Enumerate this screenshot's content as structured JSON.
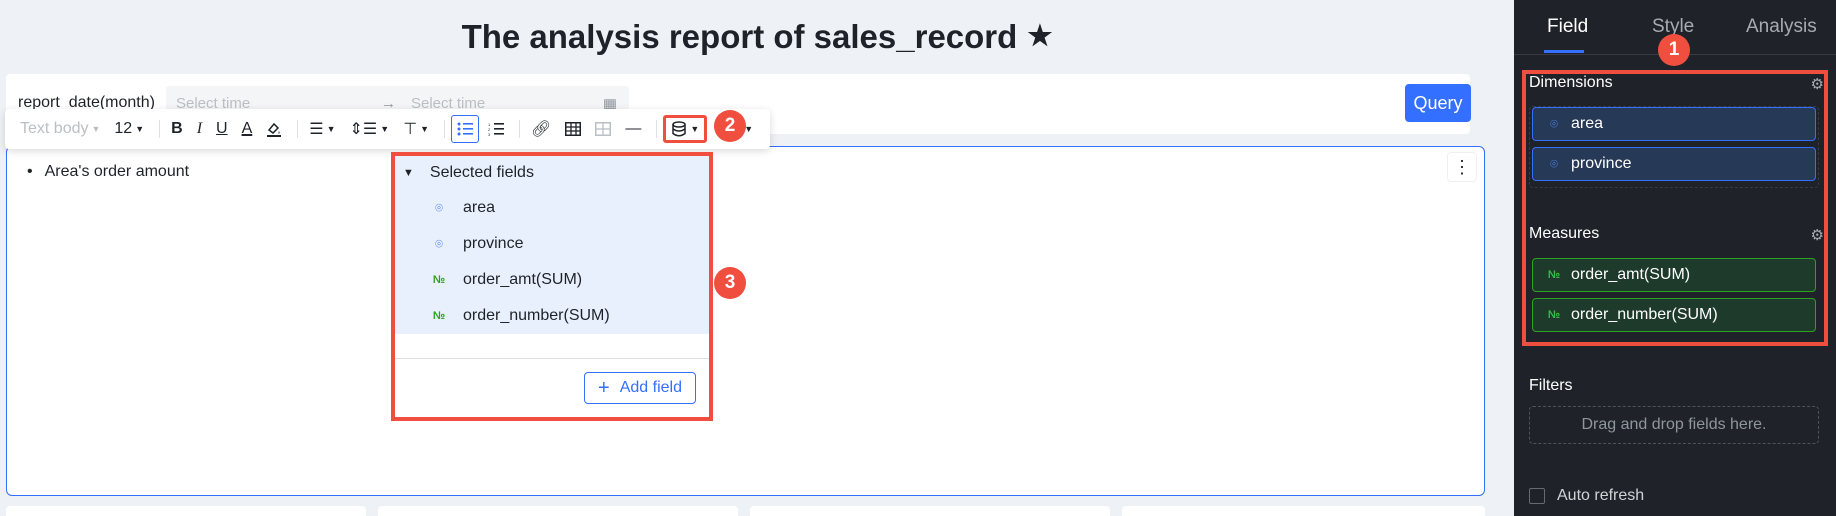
{
  "report": {
    "title": "The analysis report of sales_record",
    "star_icon": "star-icon"
  },
  "filter": {
    "label": "report_date(month)",
    "start_placeholder": "Select time",
    "end_placeholder": "Select time",
    "arrow": "→",
    "query_label": "Query"
  },
  "toolbar": {
    "paragraph_style": "Text body",
    "font_size": "12",
    "bold": "B",
    "italic": "I",
    "underline": "U",
    "font_color": "A"
  },
  "editor": {
    "bullet_text": "Area's order amount"
  },
  "dropdown": {
    "header": "Selected fields",
    "items": [
      {
        "label": "area",
        "type": "geo"
      },
      {
        "label": "province",
        "type": "geo"
      },
      {
        "label": "order_amt(SUM)",
        "type": "num"
      },
      {
        "label": "order_number(SUM)",
        "type": "num"
      }
    ],
    "add_label": "Add field"
  },
  "badges": [
    "1",
    "2",
    "3"
  ],
  "panel": {
    "tabs": [
      "Field",
      "Style",
      "Analysis"
    ],
    "active_tab": "Field",
    "dimensions_title": "Dimensions",
    "dimensions": [
      "area",
      "province"
    ],
    "measures_title": "Measures",
    "measures": [
      "order_amt(SUM)",
      "order_number(SUM)"
    ],
    "filters_title": "Filters",
    "drop_hint": "Drag and drop fields here.",
    "auto_refresh": "Auto refresh"
  },
  "colors": {
    "accent": "#3370ff",
    "highlight": "#f04e3e",
    "panel_bg": "#1f2329",
    "measure": "#2ea121"
  }
}
